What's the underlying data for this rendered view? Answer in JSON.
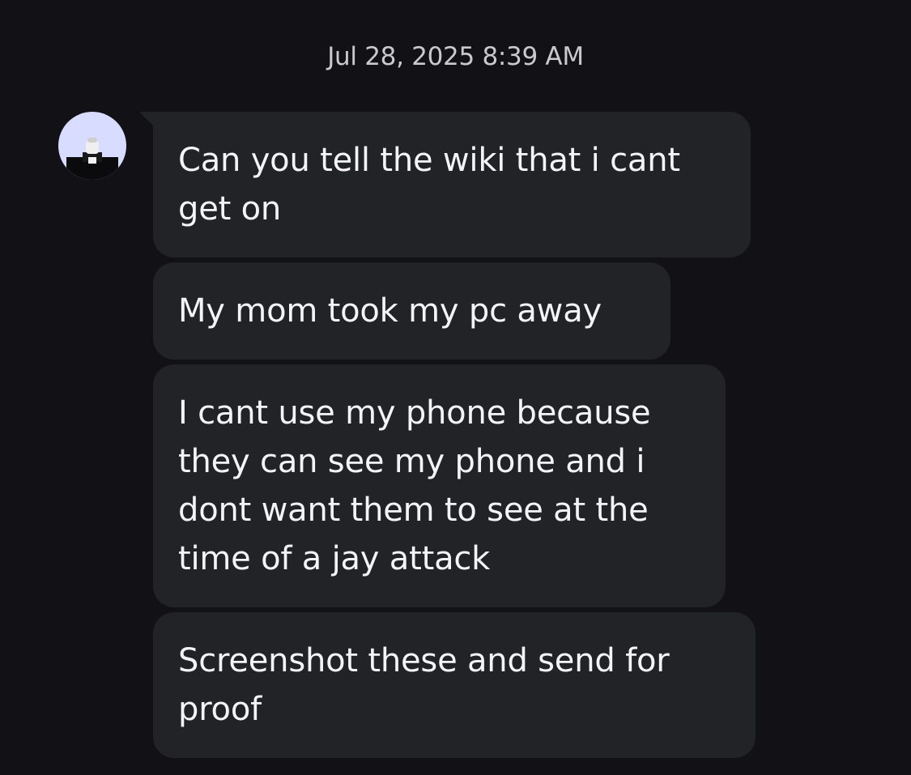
{
  "chat": {
    "timestamp": "Jul 28, 2025 8:39 AM",
    "avatar_icon": "roblox-avatar-icon",
    "messages": [
      {
        "text": "Can you tell the wiki that i cant get on"
      },
      {
        "text": "My mom took my pc away"
      },
      {
        "text": "I cant use my phone because they can see my phone and i dont want them to see at the time of a jay attack"
      },
      {
        "text": "Screenshot these and send for proof"
      }
    ]
  },
  "colors": {
    "background": "#121116",
    "bubble": "#222327",
    "text": "#f4f4f6",
    "timestamp": "#c9c9ce",
    "avatar_bg": "#d8dcff"
  }
}
